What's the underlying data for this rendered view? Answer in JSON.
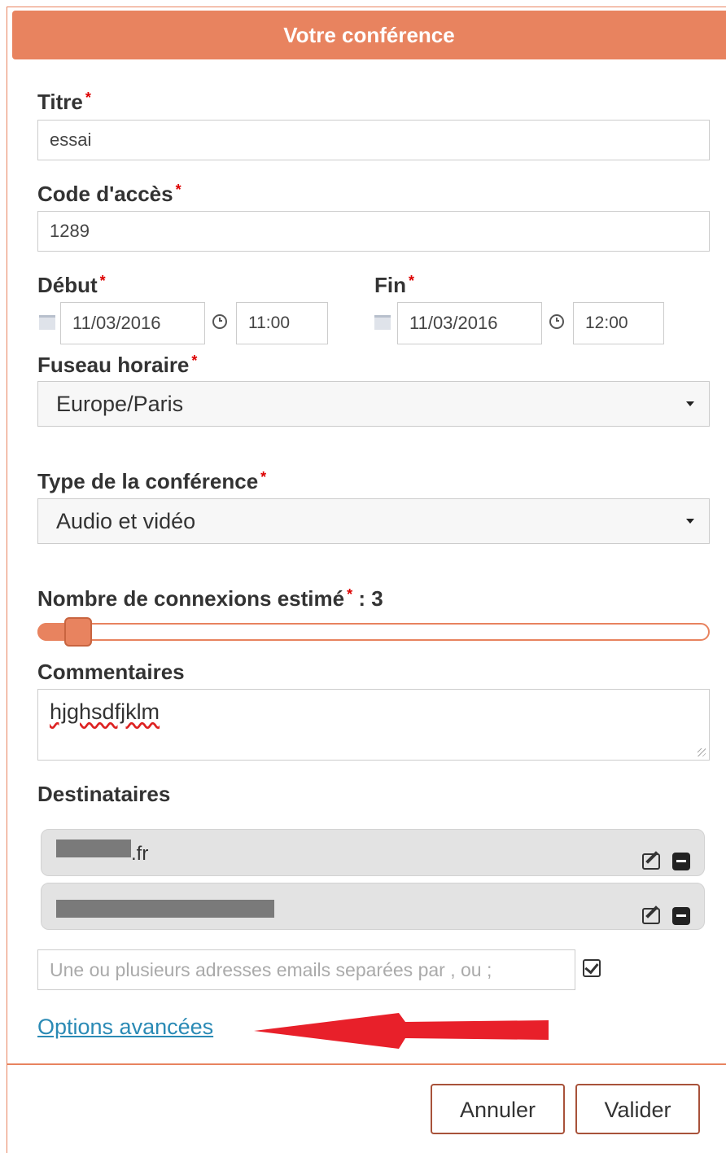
{
  "header": {
    "title": "Votre conférence"
  },
  "form": {
    "titre": {
      "label": "Titre",
      "required": "*",
      "value": "essai"
    },
    "code": {
      "label": "Code d'accès",
      "required": "*",
      "value": "1289"
    },
    "debut": {
      "label": "Début",
      "required": "*",
      "date": "11/03/2016",
      "time": "11:00"
    },
    "fin": {
      "label": "Fin",
      "required": "*",
      "date": "11/03/2016",
      "time": "12:00"
    },
    "fuseau": {
      "label": "Fuseau horaire",
      "required": "*",
      "value": "Europe/Paris"
    },
    "type": {
      "label": "Type de la conférence",
      "required": "*",
      "value": "Audio et vidéo"
    },
    "connexions": {
      "label": "Nombre de connexions estimé",
      "required": "*",
      "suffix": " : 3",
      "value": 3,
      "slider_fraction": 0.06
    },
    "commentaires": {
      "label": "Commentaires",
      "value": "hjghsdfjklm"
    },
    "destinataires": {
      "label": "Destinataires",
      "items": [
        {
          "visible_text": ".fr"
        },
        {
          "visible_text": ""
        }
      ],
      "email_placeholder": "Une ou plusieurs adresses emails separées par , ou ;"
    },
    "options_link": "Options avancées"
  },
  "buttons": {
    "cancel": "Annuler",
    "validate": "Valider"
  },
  "icons": {
    "calendar": "calendar-icon",
    "clock": "clock-icon",
    "edit": "edit-icon",
    "remove": "minus-square-icon",
    "check": "check-square-icon",
    "arrow": "red-arrow-annotation"
  },
  "colors": {
    "accent": "#e8835f",
    "link": "#2a8ab5",
    "required": "#dd0000",
    "annotation": "#e8202a"
  }
}
